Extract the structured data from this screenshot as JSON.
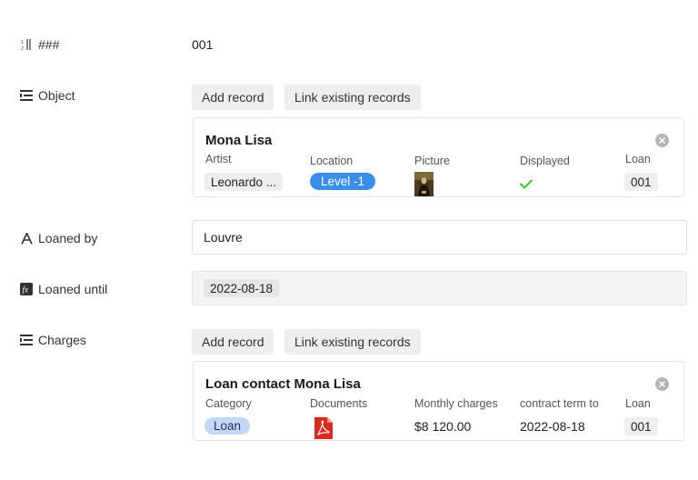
{
  "fields": {
    "id": {
      "label": "###",
      "icon": "autonumber-icon",
      "value": "001"
    },
    "object": {
      "label": "Object",
      "icon": "linked-records-icon"
    },
    "loaned_by": {
      "label": "Loaned by",
      "icon": "text-field-icon",
      "value": "Louvre"
    },
    "loaned_until": {
      "label": "Loaned until",
      "icon": "formula-icon",
      "value": "2022-08-18"
    },
    "charges": {
      "label": "Charges",
      "icon": "linked-records-icon"
    }
  },
  "buttons": {
    "add_record": "Add record",
    "link_existing": "Link existing records"
  },
  "object_card": {
    "title": "Mona Lisa",
    "columns": {
      "artist": {
        "label": "Artist",
        "value": "Leonardo ..."
      },
      "location": {
        "label": "Location",
        "value": "Level -1",
        "color": "#3b8ee8"
      },
      "picture": {
        "label": "Picture",
        "icon": "painting-thumbnail-icon"
      },
      "displayed": {
        "label": "Displayed",
        "icon": "checkmark-icon",
        "color": "#3cc13b"
      },
      "loan": {
        "label": "Loan",
        "value": "001"
      }
    }
  },
  "charges_card": {
    "title": "Loan contact Mona Lisa",
    "columns": {
      "category": {
        "label": "Category",
        "value": "Loan",
        "color": "#c5d6f7"
      },
      "documents": {
        "label": "Documents",
        "icon": "pdf-file-icon"
      },
      "monthly_charges": {
        "label": "Monthly charges",
        "value": "$8 120.00"
      },
      "contract_term": {
        "label": "contract term to",
        "value": "2022-08-18"
      },
      "loan": {
        "label": "Loan",
        "value": "001"
      }
    }
  }
}
